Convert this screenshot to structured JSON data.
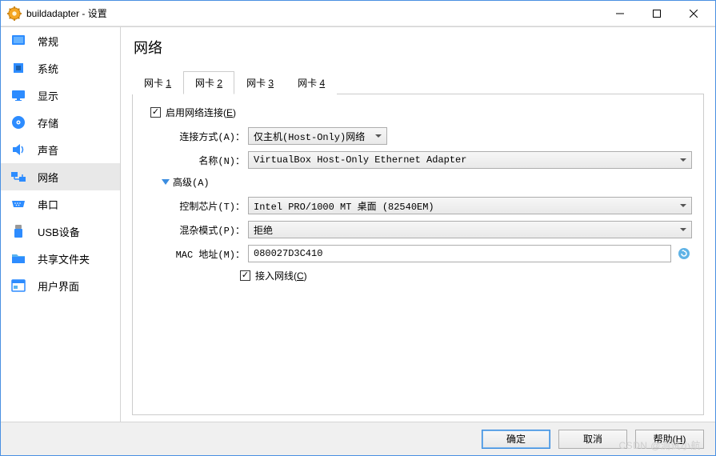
{
  "window": {
    "title": "buildadapter - 设置"
  },
  "sidebar": {
    "items": [
      {
        "label": "常规",
        "icon": "general"
      },
      {
        "label": "系统",
        "icon": "system"
      },
      {
        "label": "显示",
        "icon": "display"
      },
      {
        "label": "存储",
        "icon": "storage"
      },
      {
        "label": "声音",
        "icon": "audio"
      },
      {
        "label": "网络",
        "icon": "network",
        "selected": true
      },
      {
        "label": "串口",
        "icon": "serial"
      },
      {
        "label": "USB设备",
        "icon": "usb"
      },
      {
        "label": "共享文件夹",
        "icon": "shared"
      },
      {
        "label": "用户界面",
        "icon": "ui"
      }
    ]
  },
  "main": {
    "title": "网络",
    "tabs": [
      {
        "prefix": "网卡 ",
        "num": "1"
      },
      {
        "prefix": "网卡 ",
        "num": "2",
        "active": true
      },
      {
        "prefix": "网卡 ",
        "num": "3"
      },
      {
        "prefix": "网卡 ",
        "num": "4"
      }
    ],
    "form": {
      "enable_label_pre": "启用网络连接(",
      "enable_label_accel": "E",
      "enable_label_post": ")",
      "enable_checked": true,
      "attach_label": "连接方式(A)：",
      "attach_value": "仅主机(Host-Only)网络",
      "name_label": "名称(N)：",
      "name_value": "VirtualBox Host-Only Ethernet Adapter",
      "advanced_label": "高级(A)",
      "adapter_type_label": "控制芯片(T)：",
      "adapter_type_value": "Intel PRO/1000 MT 桌面 (82540EM)",
      "promisc_label": "混杂模式(P)：",
      "promisc_value": "拒绝",
      "mac_label": "MAC 地址(M)：",
      "mac_value": "080027D3C410",
      "cable_label_pre": "接入网线(",
      "cable_label_accel": "C",
      "cable_label_post": ")",
      "cable_checked": true
    }
  },
  "footer": {
    "ok": "确定",
    "cancel": "取消",
    "help_pre": "帮助(",
    "help_accel": "H",
    "help_post": ")"
  },
  "watermark": "CSDN @测试小航"
}
